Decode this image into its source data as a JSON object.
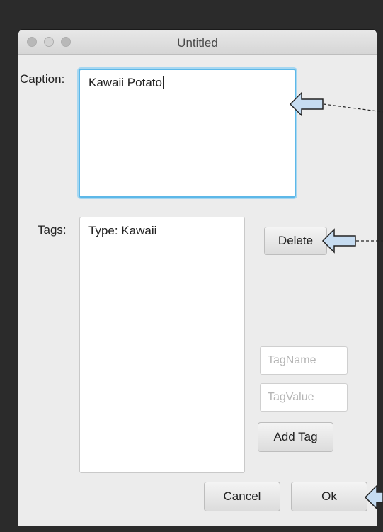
{
  "window": {
    "title": "Untitled"
  },
  "caption": {
    "label": "Caption:",
    "value": "Kawaii Potato"
  },
  "tags": {
    "label": "Tags:",
    "items": [
      "Type: Kawaii"
    ]
  },
  "buttons": {
    "delete": "Delete",
    "add_tag": "Add Tag",
    "cancel": "Cancel",
    "ok": "Ok"
  },
  "fields": {
    "tag_name_placeholder": "TagName",
    "tag_value_placeholder": "TagValue"
  },
  "annotation": {
    "arrow_fill": "#c6dcf1",
    "arrow_stroke": "#222222"
  }
}
